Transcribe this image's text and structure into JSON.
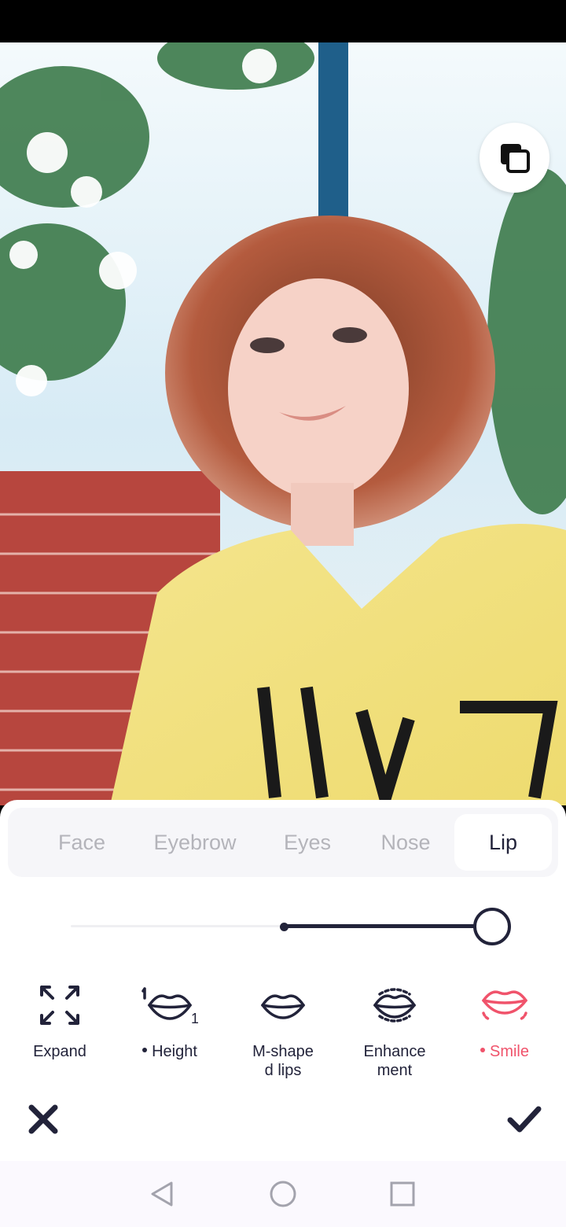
{
  "tabs": [
    "Face",
    "Eyebrow",
    "Eyes",
    "Nose",
    "Lip"
  ],
  "active_tab": "Lip",
  "slider": {
    "value": 0.5,
    "note": "fill from center to right end"
  },
  "tools": [
    {
      "label": "Expand",
      "icon": "expand-arrows-icon",
      "dot": false,
      "active": false
    },
    {
      "label": "Height",
      "icon": "lip-height-icon",
      "dot": true,
      "active": false
    },
    {
      "label": "M-shape\nd lips",
      "icon": "lips-icon",
      "dot": false,
      "active": false
    },
    {
      "label": "Enhance\nment",
      "icon": "lips-enhance-icon",
      "dot": false,
      "active": false
    },
    {
      "label": "Smile",
      "icon": "smile-lips-icon",
      "dot": true,
      "active": true
    }
  ],
  "colors": {
    "accent": "#f0536b",
    "dark": "#22233a",
    "inactive_text": "#b4b4ba"
  }
}
